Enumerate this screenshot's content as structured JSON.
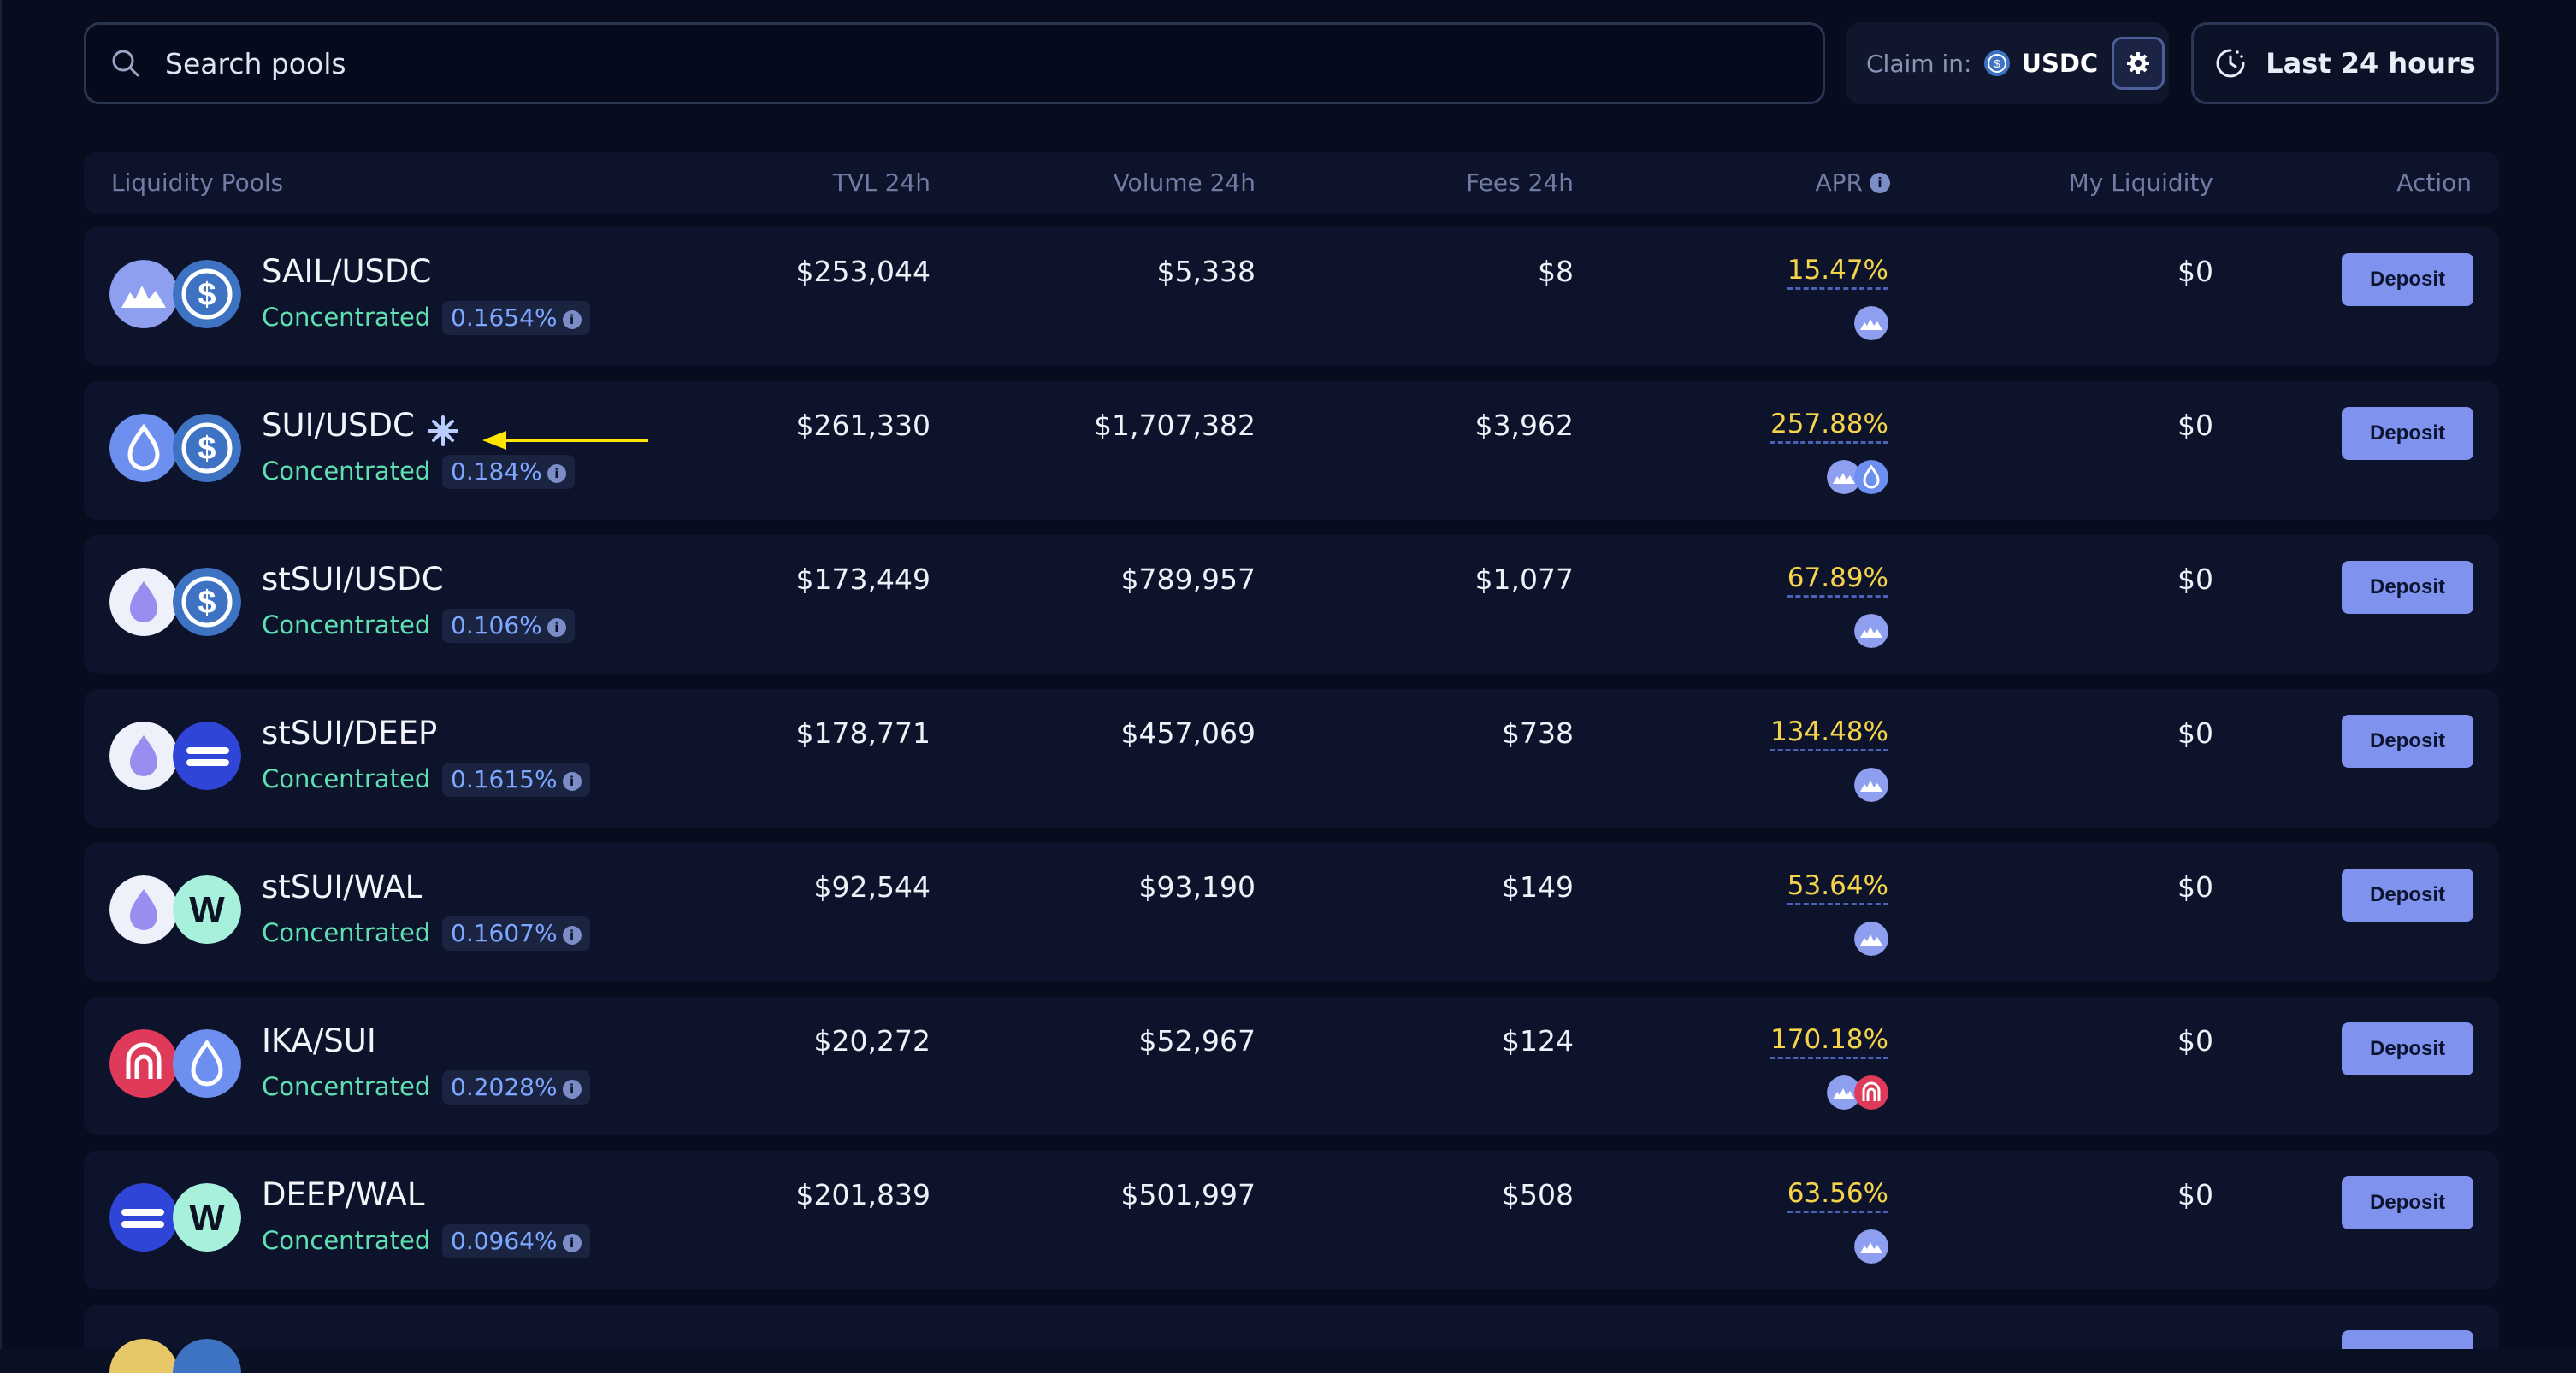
{
  "search": {
    "placeholder": "Search pools"
  },
  "claim": {
    "label": "Claim in:",
    "token": "USDC"
  },
  "time_range": {
    "label": "Last 24 hours"
  },
  "table": {
    "columns": [
      "Liquidity Pools",
      "TVL 24h",
      "Volume 24h",
      "Fees 24h",
      "APR",
      "My Liquidity",
      "Action"
    ],
    "rows": [
      {
        "pair": "SAIL/USDC",
        "type": "Concentrated",
        "fee": "0.1654%",
        "tvl": "$253,044",
        "volume": "$5,338",
        "fees": "$8",
        "apr": "15.47%",
        "my_liquidity": "$0",
        "action": "Deposit"
      },
      {
        "pair": "SUI/USDC",
        "type": "Concentrated",
        "fee": "0.184%",
        "tvl": "$261,330",
        "volume": "$1,707,382",
        "fees": "$3,962",
        "apr": "257.88%",
        "my_liquidity": "$0",
        "action": "Deposit"
      },
      {
        "pair": "stSUI/USDC",
        "type": "Concentrated",
        "fee": "0.106%",
        "tvl": "$173,449",
        "volume": "$789,957",
        "fees": "$1,077",
        "apr": "67.89%",
        "my_liquidity": "$0",
        "action": "Deposit"
      },
      {
        "pair": "stSUI/DEEP",
        "type": "Concentrated",
        "fee": "0.1615%",
        "tvl": "$178,771",
        "volume": "$457,069",
        "fees": "$738",
        "apr": "134.48%",
        "my_liquidity": "$0",
        "action": "Deposit"
      },
      {
        "pair": "stSUI/WAL",
        "type": "Concentrated",
        "fee": "0.1607%",
        "tvl": "$92,544",
        "volume": "$93,190",
        "fees": "$149",
        "apr": "53.64%",
        "my_liquidity": "$0",
        "action": "Deposit"
      },
      {
        "pair": "IKA/SUI",
        "type": "Concentrated",
        "fee": "0.2028%",
        "tvl": "$20,272",
        "volume": "$52,967",
        "fees": "$124",
        "apr": "170.18%",
        "my_liquidity": "$0",
        "action": "Deposit"
      },
      {
        "pair": "DEEP/WAL",
        "type": "Concentrated",
        "fee": "0.0964%",
        "tvl": "$201,839",
        "volume": "$501,997",
        "fees": "$508",
        "apr": "63.56%",
        "my_liquidity": "$0",
        "action": "Deposit"
      }
    ]
  },
  "colors": {
    "background": "#070c1f",
    "row": "#0c132a",
    "accent_green": "#5fe0b2",
    "apr_yellow": "#f5d34a",
    "deposit_button": "#7e92ee"
  },
  "icons": {
    "search": "search-icon",
    "claim_token": "usdc-icon",
    "settings": "gear-icon",
    "time": "clock-icon",
    "apr_info": "info-icon"
  }
}
